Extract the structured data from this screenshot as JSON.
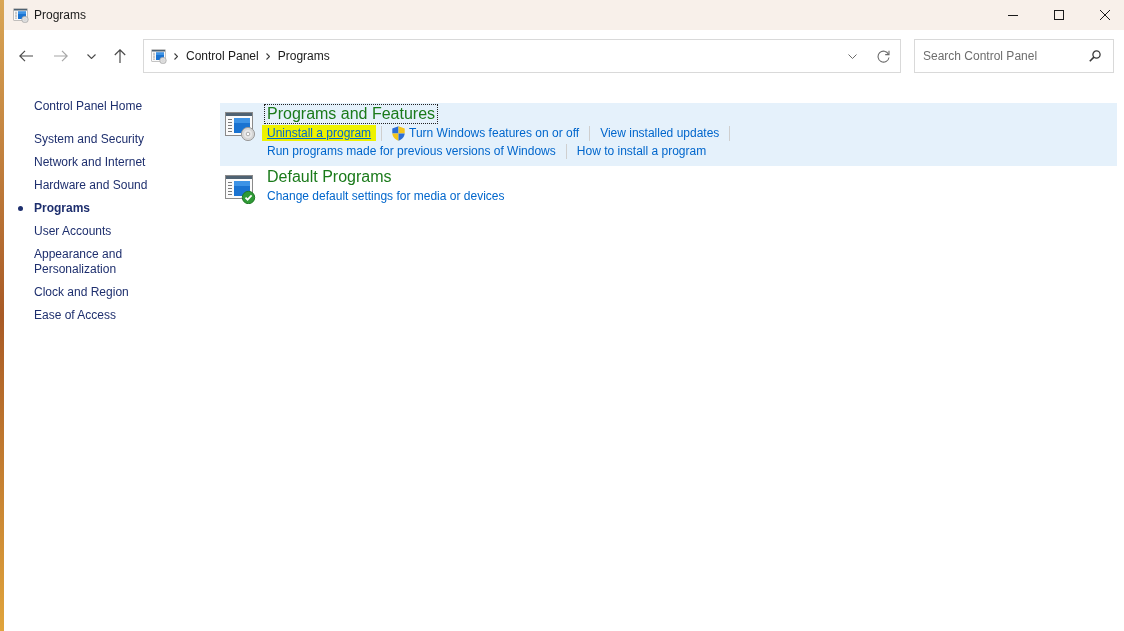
{
  "window": {
    "title": "Programs"
  },
  "navigation": [
    {
      "kind": "back",
      "disabled": false
    },
    {
      "kind": "forward",
      "disabled": true
    },
    {
      "kind": "recent",
      "disabled": false
    },
    {
      "kind": "up",
      "disabled": false
    }
  ],
  "address_bar": {
    "breadcrumbs": [
      "Control Panel",
      "Programs"
    ]
  },
  "search": {
    "placeholder": "Search Control Panel"
  },
  "sidebar": {
    "home": "Control Panel Home",
    "items": [
      {
        "label": "System and Security",
        "selected": false
      },
      {
        "label": "Network and Internet",
        "selected": false
      },
      {
        "label": "Hardware and Sound",
        "selected": false
      },
      {
        "label": "Programs",
        "selected": true
      },
      {
        "label": "User Accounts",
        "selected": false
      },
      {
        "label": "Appearance and Personalization",
        "selected": false
      },
      {
        "label": "Clock and Region",
        "selected": false
      },
      {
        "label": "Ease of Access",
        "selected": false
      }
    ]
  },
  "categories": [
    {
      "kind": "disc",
      "title": "Programs and Features",
      "hovered": true,
      "focused": true,
      "link_rows": [
        [
          {
            "label": "Uninstall a program",
            "shield": false,
            "highlighted": true,
            "divider": true
          },
          {
            "label": "Turn Windows features on or off",
            "shield": true,
            "highlighted": false,
            "divider": true
          },
          {
            "label": "View installed updates",
            "shield": false,
            "highlighted": false,
            "divider": true
          }
        ],
        [
          {
            "label": "Run programs made for previous versions of Windows",
            "shield": false,
            "highlighted": false,
            "divider": true
          },
          {
            "label": "How to install a program",
            "shield": false,
            "highlighted": false,
            "divider": false
          }
        ]
      ]
    },
    {
      "kind": "check",
      "title": "Default Programs",
      "hovered": false,
      "focused": false,
      "link_rows": [
        [
          {
            "label": "Change default settings for media or devices",
            "shield": false,
            "highlighted": false,
            "divider": false
          }
        ]
      ]
    }
  ]
}
